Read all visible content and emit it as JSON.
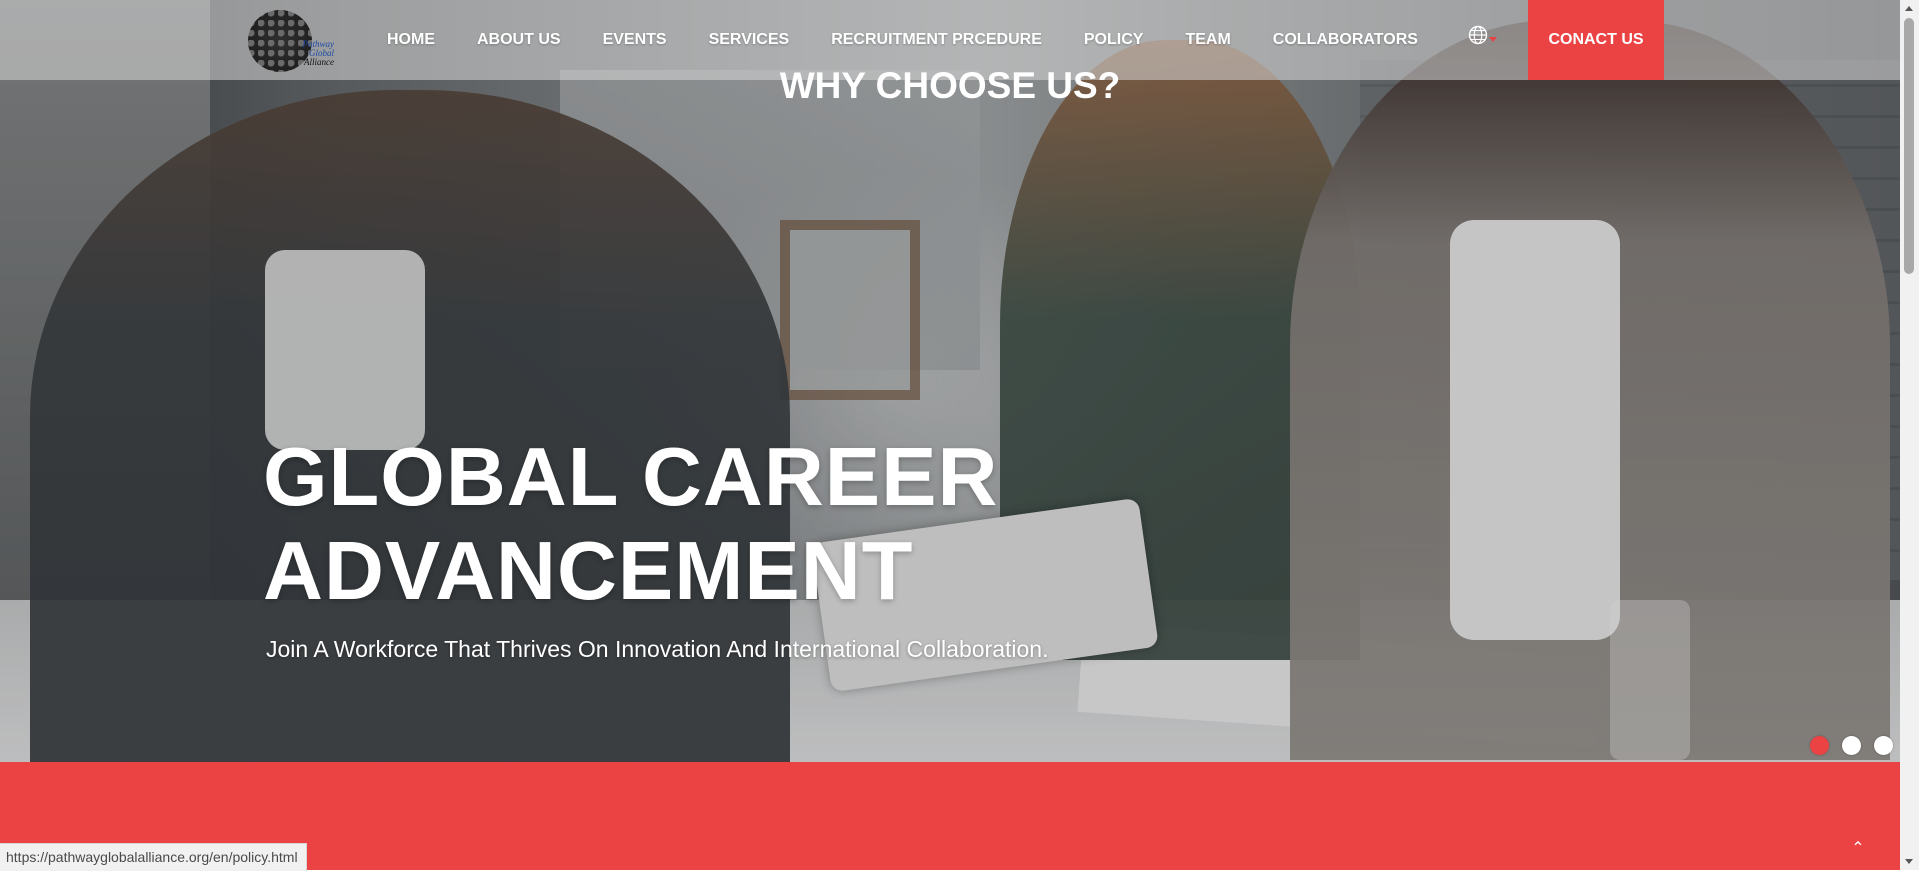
{
  "nav": {
    "logo": {
      "line1": "Pathway",
      "line2": "Global",
      "line3": "Alliance"
    },
    "items": [
      {
        "label": "HOME"
      },
      {
        "label": "ABOUT US"
      },
      {
        "label": "EVENTS"
      },
      {
        "label": "SERVICES"
      },
      {
        "label": "RECRUITMENT PRCEDURE"
      },
      {
        "label": "POLICY"
      },
      {
        "label": "TEAM"
      },
      {
        "label": "COLLABORATORS"
      }
    ],
    "language_icon": "globe-icon",
    "contact_label": "CONACT US"
  },
  "hero": {
    "title_line1": "GLOBAL CAREER",
    "title_line2": "ADVANCEMENT",
    "subtitle": "Join A Workforce That Thrives On Innovation And International Collaboration.",
    "slides": {
      "count": 3,
      "active_index": 1
    }
  },
  "why": {
    "title": "WHY CHOOSE US?"
  },
  "back_to_top_icon": "chevron-up-icon",
  "status_bar": {
    "url": "https://pathwayglobalalliance.org/en/policy.html"
  },
  "colors": {
    "accent": "#eb4244",
    "text_light": "#ffffff",
    "nav_overlay": "rgba(215,215,215,0.55)"
  }
}
